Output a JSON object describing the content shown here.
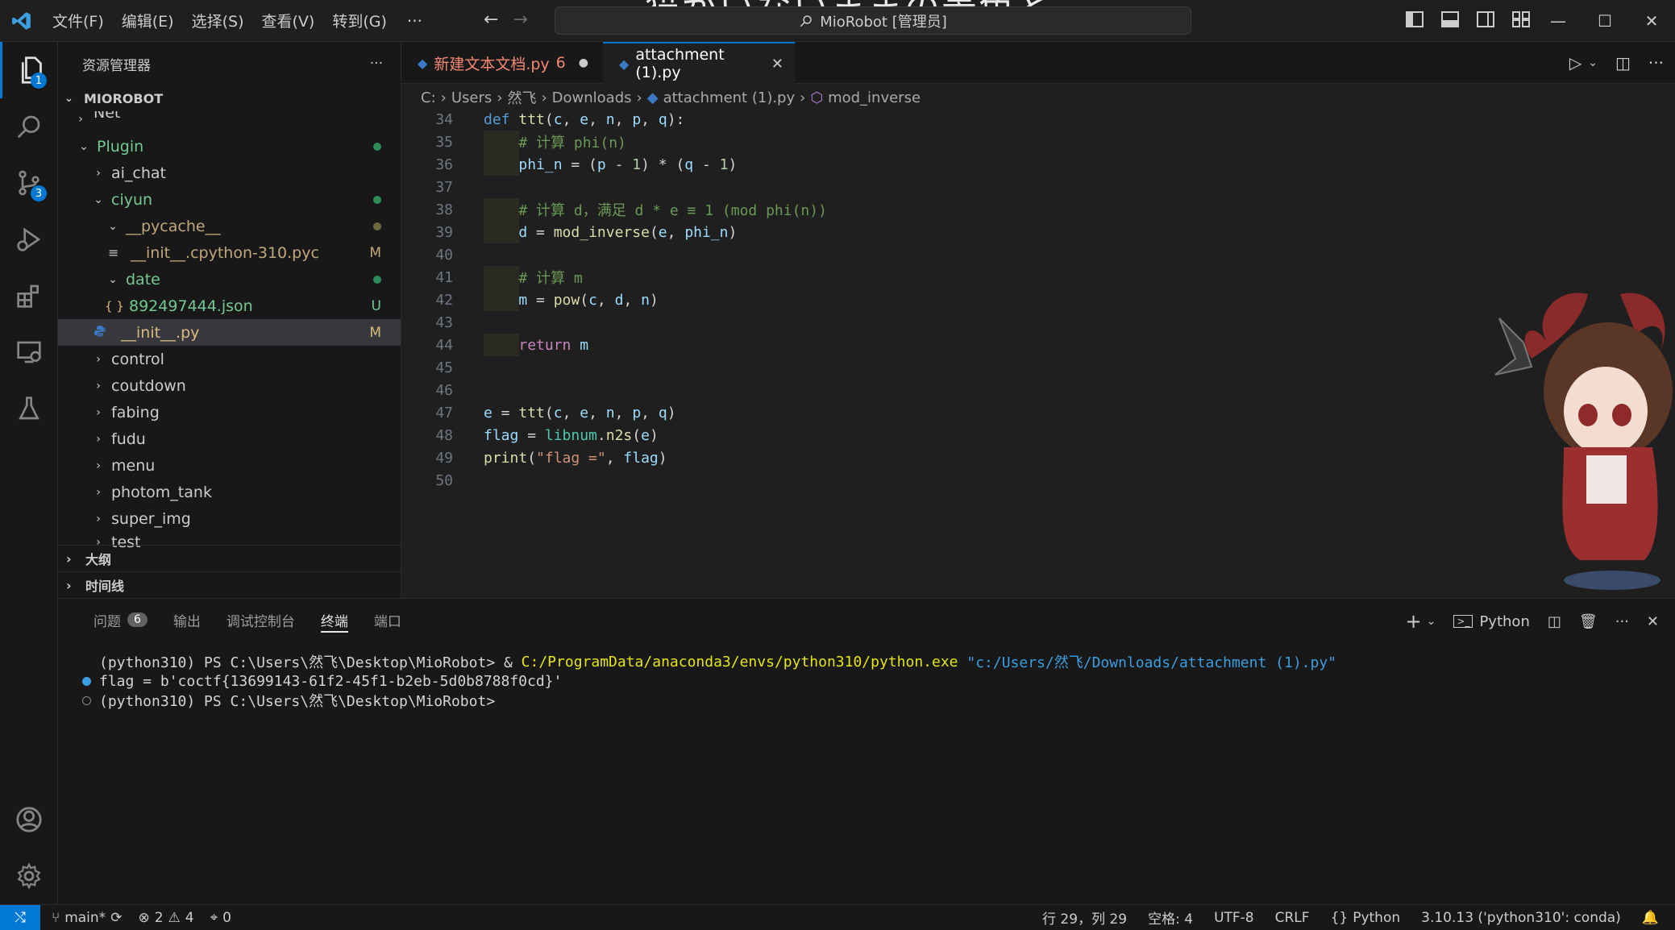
{
  "titlebar": {
    "menus": [
      "文件(F)",
      "编辑(E)",
      "选择(S)",
      "查看(V)",
      "转到(G)"
    ],
    "more": "···",
    "search_text": "MioRobot [管理员]",
    "overlay_text": "猫がいないままの景色と"
  },
  "activity": {
    "explorer_badge": "1",
    "scm_badge": "3"
  },
  "sidebar": {
    "header": "资源管理器",
    "more": "···",
    "root": "MIOROBOT",
    "items": [
      {
        "label": "Net",
        "status": ""
      },
      {
        "label": "Plugin",
        "status": ""
      },
      {
        "label": "ai_chat",
        "status": ""
      },
      {
        "label": "ciyun",
        "status": ""
      },
      {
        "label": "__pycache__",
        "status": ""
      },
      {
        "label": "__init__.cpython-310.pyc",
        "status": "M"
      },
      {
        "label": "date",
        "status": ""
      },
      {
        "label": "892497444.json",
        "status": "U"
      },
      {
        "label": "__init__.py",
        "status": "M"
      },
      {
        "label": "control",
        "status": ""
      },
      {
        "label": "coutdown",
        "status": ""
      },
      {
        "label": "fabing",
        "status": ""
      },
      {
        "label": "fudu",
        "status": ""
      },
      {
        "label": "menu",
        "status": ""
      },
      {
        "label": "photom_tank",
        "status": ""
      },
      {
        "label": "super_img",
        "status": ""
      },
      {
        "label": "test",
        "status": ""
      }
    ],
    "sections": [
      "大纲",
      "时间线"
    ]
  },
  "tabs": [
    {
      "label": "新建文本文档.py",
      "count": "6"
    },
    {
      "label": "attachment (1).py",
      "close": "✕"
    }
  ],
  "breadcrumb": [
    "C:",
    "Users",
    "然飞",
    "Downloads",
    "attachment (1).py",
    "mod_inverse"
  ],
  "code": {
    "line_numbers": [
      "34",
      "35",
      "36",
      "37",
      "38",
      "39",
      "40",
      "41",
      "42",
      "43",
      "44",
      "45",
      "46",
      "47",
      "48",
      "49",
      "50"
    ]
  },
  "panel": {
    "tabs": [
      "问题",
      "输出",
      "调试控制台",
      "终端",
      "端口"
    ],
    "problems_count": "6",
    "shell_label": "Python",
    "terminal": [
      {
        "prompt": "(python310) PS C:\\Users\\然飞\\Desktop\\MioRobot> & ",
        "cmd": "C:/ProgramData/anaconda3/envs/python310/python.exe",
        "arg": " \"c:/Users/然飞/Downloads/attachment (1).py\""
      },
      {
        "text": "flag = b'coctf{13699143-61f2-45f1-b2eb-5d0b8788f0cd}'"
      },
      {
        "text": "(python310) PS C:\\Users\\然飞\\Desktop\\MioRobot>"
      }
    ]
  },
  "statusbar": {
    "branch": "main*",
    "errors": "2",
    "warnings": "4",
    "ports": "0",
    "position": "行 29，列 29",
    "spaces": "空格: 4",
    "encoding": "UTF-8",
    "eol": "CRLF",
    "language": "Python",
    "interpreter": "3.10.13 ('python310': conda)"
  }
}
